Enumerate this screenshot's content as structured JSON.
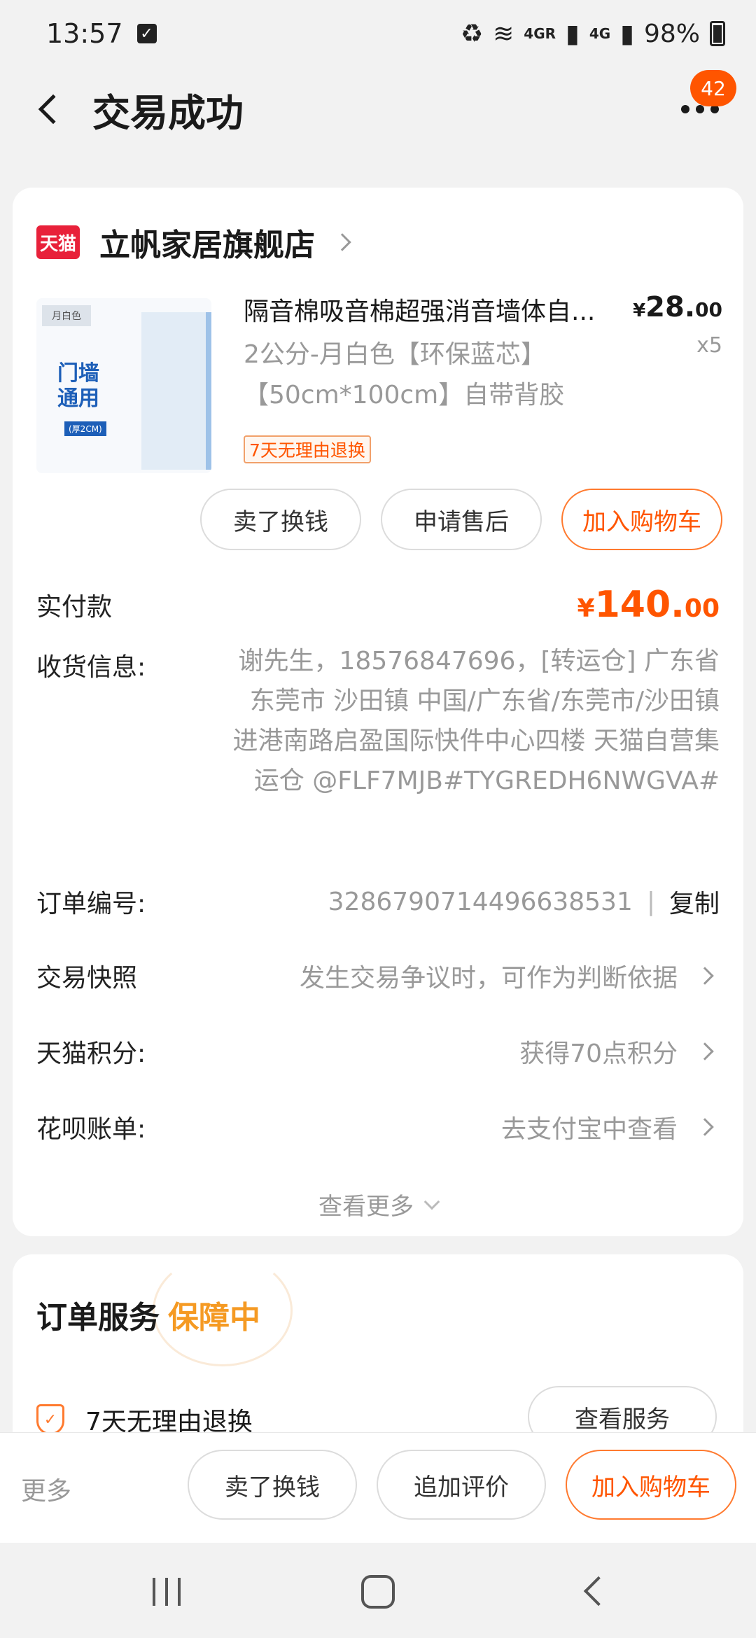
{
  "status": {
    "time": "13:57",
    "network_a": "4GR",
    "network_b": "4G",
    "battery": "98%"
  },
  "header": {
    "title": "交易成功",
    "badge_count": "42"
  },
  "shop": {
    "logo_text": "天猫",
    "name": "立帆家居旗舰店"
  },
  "product": {
    "thumb_tag": "月白色",
    "thumb_text": "门墙\n通用",
    "thumb_sub": "(厚2CM)",
    "title": "隔音棉吸音棉超强消音墙体自...",
    "price_yen": "¥",
    "price_int": "28.",
    "price_cents": "00",
    "quantity": "x5",
    "spec": "2公分-月白色【环保蓝芯】【50cm*100cm】自带背胶",
    "return_tag": "7天无理由退换"
  },
  "product_actions": {
    "sell": "卖了换钱",
    "after_sale": "申请售后",
    "add_cart": "加入购物车"
  },
  "payment": {
    "label": "实付款",
    "yen": "¥",
    "amount": "140.",
    "cents": "00"
  },
  "address": {
    "label": "收货信息:",
    "text": "谢先生，18576847696，[转运仓] 广东省 东莞市 沙田镇 中国/广东省/东莞市/沙田镇进港南路启盈国际快件中心四楼 天猫自营集运仓 @FLF7MJB#TYGREDH6NWGVA#"
  },
  "order": {
    "label": "订单编号:",
    "number": "3286790714496638531",
    "separator": "|",
    "copy": "复制"
  },
  "snapshot": {
    "label": "交易快照",
    "value": "发生交易争议时，可作为判断依据"
  },
  "points": {
    "label": "天猫积分:",
    "value": "获得70点积分"
  },
  "huabei": {
    "label": "花呗账单:",
    "value": "去支付宝中查看"
  },
  "see_more": "查看更多",
  "service": {
    "title": "订单服务",
    "status": "保障中",
    "item_label": "7天无理由退换",
    "view_button": "查看服务"
  },
  "bottom_bar": {
    "more": "更多",
    "sell": "卖了换钱",
    "review": "追加评价",
    "add_cart": "加入购物车"
  },
  "colors": {
    "accent": "#ff5500",
    "tmall_red": "#e8213a",
    "guarantee": "#f59a23"
  }
}
